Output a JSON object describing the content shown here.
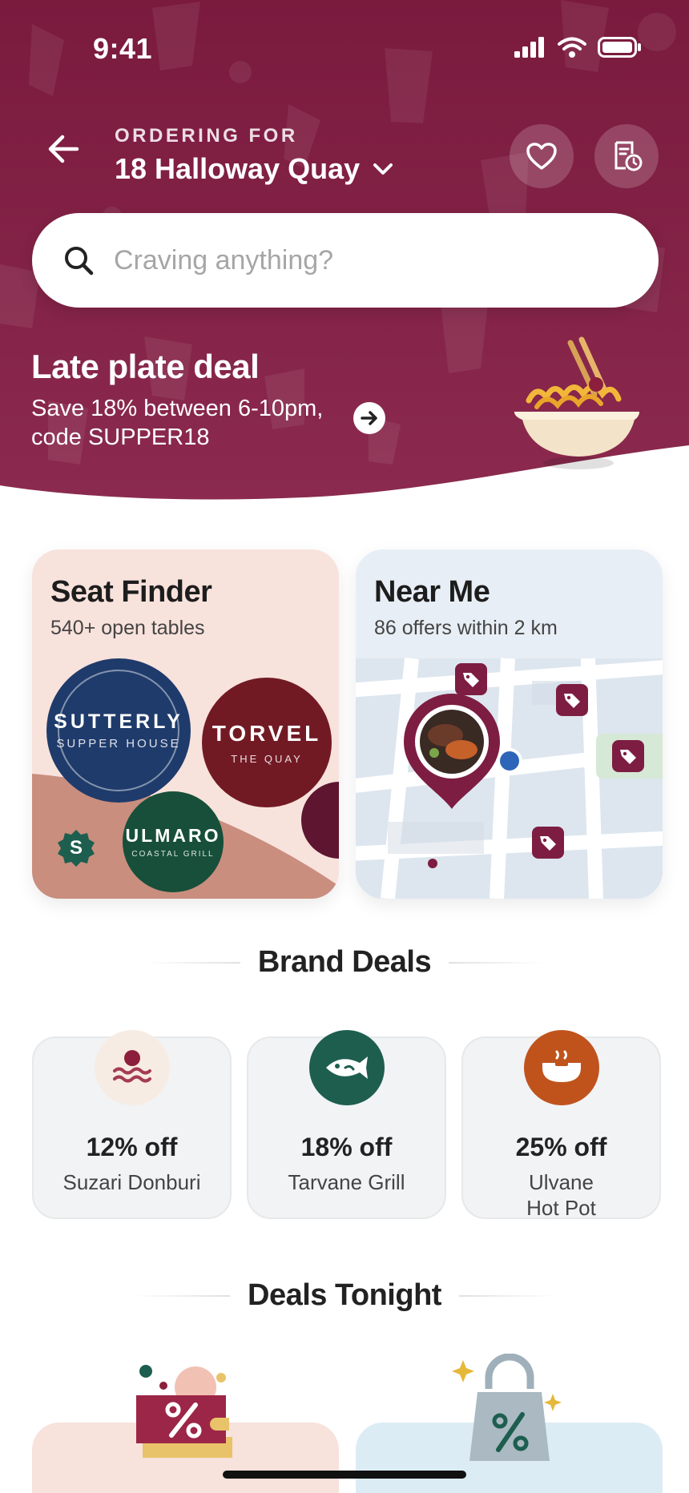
{
  "status_bar": {
    "time": "9:41"
  },
  "header": {
    "ordering_label": "ORDERING FOR",
    "address": "18 Halloway Quay"
  },
  "search": {
    "placeholder": "Craving anything?"
  },
  "promo": {
    "title": "Late plate deal",
    "text": "Save 18% between 6-10pm, code SUPPER18"
  },
  "seat_finder": {
    "title": "Seat Finder",
    "subtitle": "540+ open tables",
    "brands": [
      {
        "name": "SUTTERLY",
        "sub": "SUPPER HOUSE"
      },
      {
        "name": "TORVEL",
        "sub": "THE QUAY"
      },
      {
        "name": "ULMARO",
        "sub": "COASTAL GRILL"
      }
    ],
    "badge": "S"
  },
  "near_me": {
    "title": "Near Me",
    "subtitle": "86 offers within 2 km"
  },
  "brand_deals": {
    "heading": "Brand Deals",
    "items": [
      {
        "discount": "12% off",
        "name": "Suzari Donburi",
        "icon": "sushi-wave-icon",
        "color": "#f7ece4"
      },
      {
        "discount": "18% off",
        "name": "Tarvane Grill",
        "icon": "fish-icon",
        "color": "#1d5e4f"
      },
      {
        "discount": "25% off",
        "name": "Ulvane Hot Pot",
        "icon": "hot-pot-icon",
        "color": "#c0531c"
      }
    ]
  },
  "deals_tonight": {
    "heading": "Deals Tonight"
  },
  "colors": {
    "brand": "#7d1d42",
    "seat_card": "#f8e2dc",
    "near_card": "#e8eef5",
    "sutterly": "#1f3b6b",
    "torvel": "#721a24",
    "ulmaro": "#174f3a"
  }
}
